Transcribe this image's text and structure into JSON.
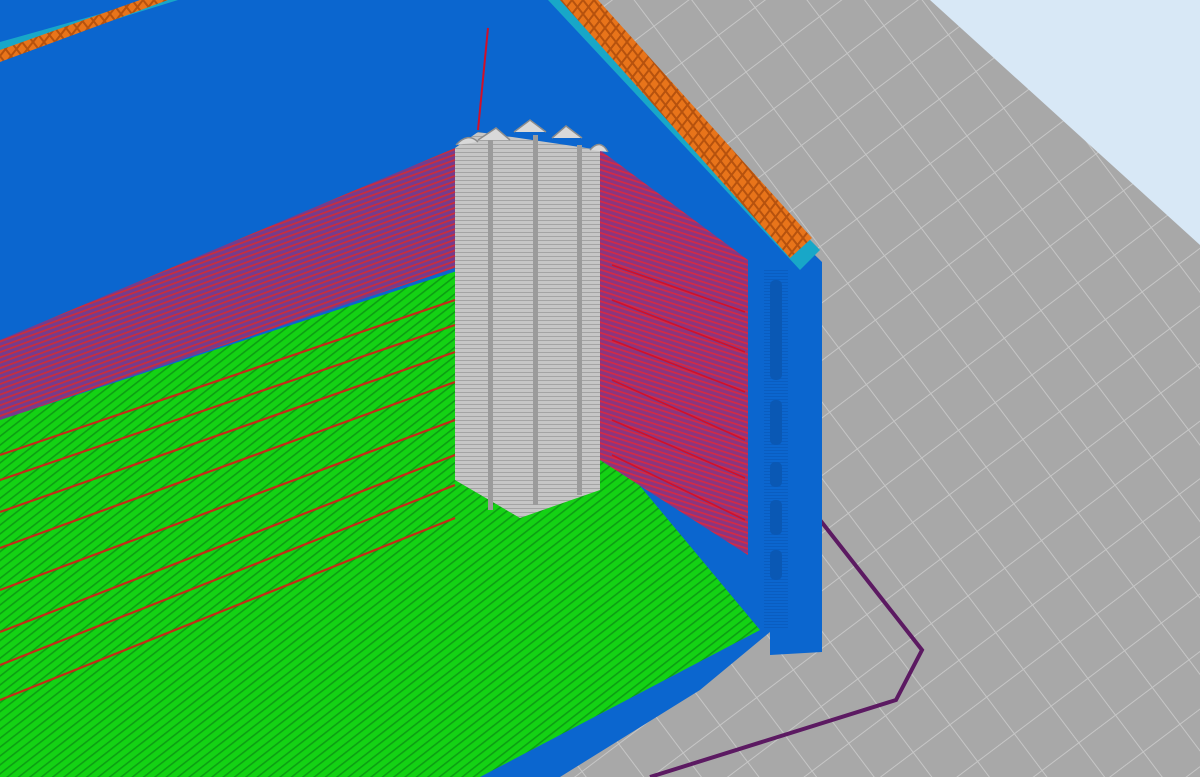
{
  "viewport": {
    "kind": "3d-slicer-gcode-preview",
    "colors": {
      "sky": "#d8e8f6",
      "bed_plate": "#a9a9a9",
      "bed_grid_line": "#c4c4c4",
      "skirt": "#5c1a62",
      "perimeter": "#0b66cf",
      "perimeter_dark": "#0a58b4",
      "external_perimeter": "#18a7c8",
      "infill": "#e8741a",
      "top_solid": "#14d214",
      "top_solid_line": "#c52a18",
      "wipe_tower": "#c4c4c4",
      "wipe_tower_shade": "#9b9b9b",
      "travel": "#c00018",
      "bridge_infill": "#9b2f73"
    },
    "objects": [
      {
        "name": "print-object-box",
        "features": [
          "perimeter",
          "external_perimeter",
          "infill",
          "top_solid",
          "bridge_infill"
        ]
      },
      {
        "name": "wipe-tower",
        "features": [
          "wipe_tower"
        ]
      },
      {
        "name": "skirt-outline",
        "features": [
          "skirt"
        ]
      }
    ]
  }
}
